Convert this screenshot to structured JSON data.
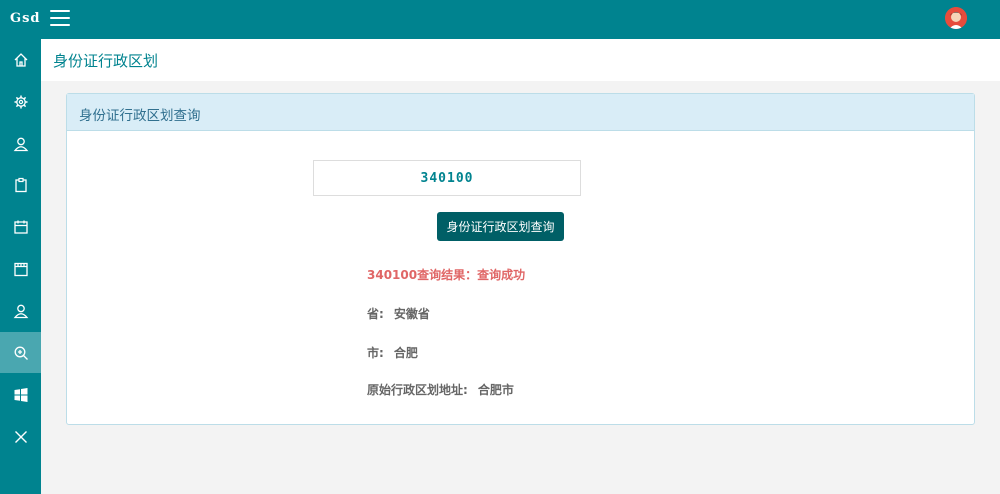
{
  "topbar": {
    "logo": "Gsd",
    "menu_icon": "hamburger-menu-icon",
    "avatar_icon": "user-avatar-icon"
  },
  "sidebar": {
    "items": [
      {
        "name": "home",
        "icon": "home-icon"
      },
      {
        "name": "settings",
        "icon": "gear-icon"
      },
      {
        "name": "user",
        "icon": "user-icon"
      },
      {
        "name": "clipboard",
        "icon": "clipboard-icon"
      },
      {
        "name": "calendar",
        "icon": "calendar-icon"
      },
      {
        "name": "calendar-alt",
        "icon": "calendar-icon"
      },
      {
        "name": "user-alt",
        "icon": "user-icon"
      },
      {
        "name": "zoom",
        "icon": "zoom-in-icon",
        "active": true
      },
      {
        "name": "windows",
        "icon": "windows-icon"
      },
      {
        "name": "close",
        "icon": "close-icon"
      }
    ]
  },
  "page": {
    "title": "身份证行政区划"
  },
  "panel": {
    "title": "身份证行政区划查询",
    "input_value": "340100",
    "button_label": "身份证行政区划查询",
    "result_status": "340100查询结果：查询成功",
    "results": [
      {
        "label": "省:",
        "value": "安徽省"
      },
      {
        "label": "市:",
        "value": "合肥"
      },
      {
        "label": "原始行政区划地址:",
        "value": "合肥市"
      }
    ]
  },
  "colors": {
    "teal": "#00838f",
    "active": "#4aa7b0",
    "button": "#005f66",
    "status": "#e06666"
  }
}
